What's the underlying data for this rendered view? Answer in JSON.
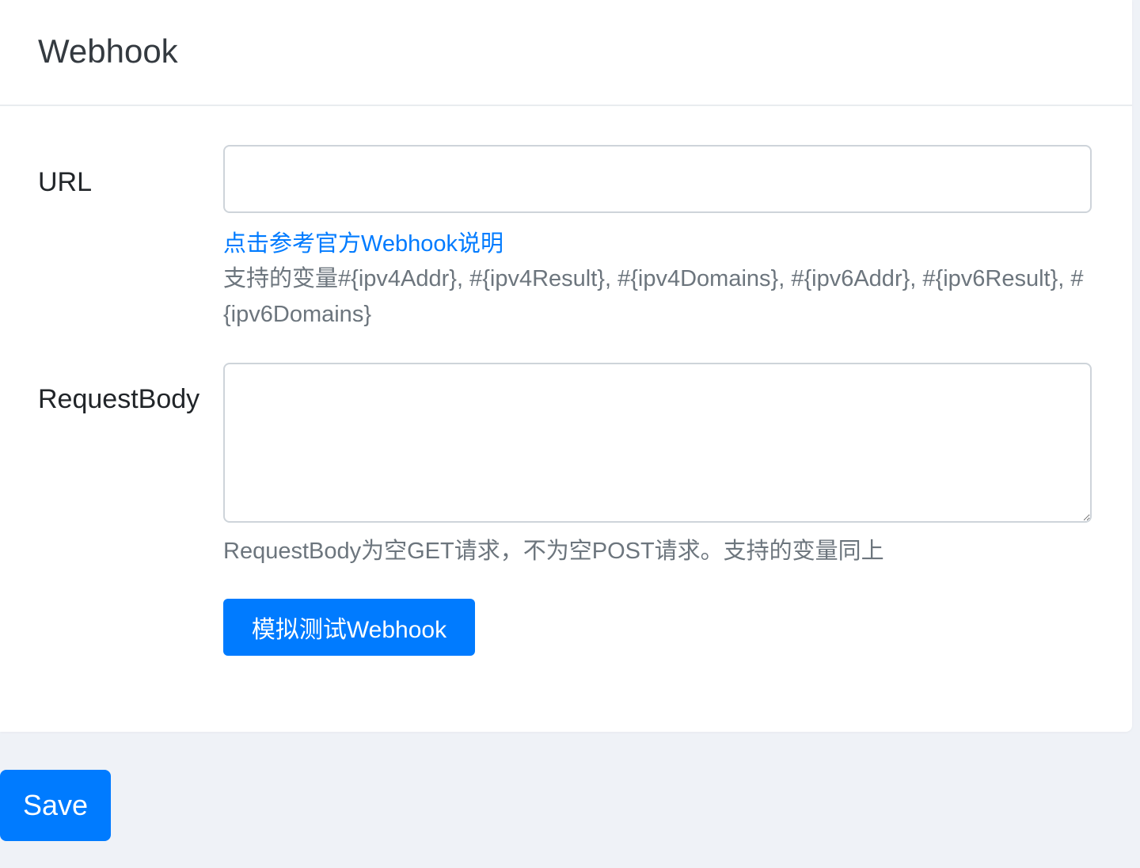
{
  "card": {
    "title": "Webhook"
  },
  "url_field": {
    "label": "URL",
    "value": "",
    "placeholder": ""
  },
  "help": {
    "link_text": "点击参考官方Webhook说明",
    "variables_text": "支持的变量#{ipv4Addr}, #{ipv4Result}, #{ipv4Domains}, #{ipv6Addr}, #{ipv6Result}, #{ipv6Domains}"
  },
  "request_body_field": {
    "label": "RequestBody",
    "value": "",
    "placeholder": "",
    "help_text": "RequestBody为空GET请求，不为空POST请求。支持的变量同上"
  },
  "buttons": {
    "test_label": "模拟测试Webhook",
    "save_label": "Save"
  },
  "colors": {
    "primary": "#007bff",
    "page_background": "#eff2f7",
    "card_background": "#ffffff",
    "muted_text": "#6c757d",
    "border": "#ced4da"
  }
}
